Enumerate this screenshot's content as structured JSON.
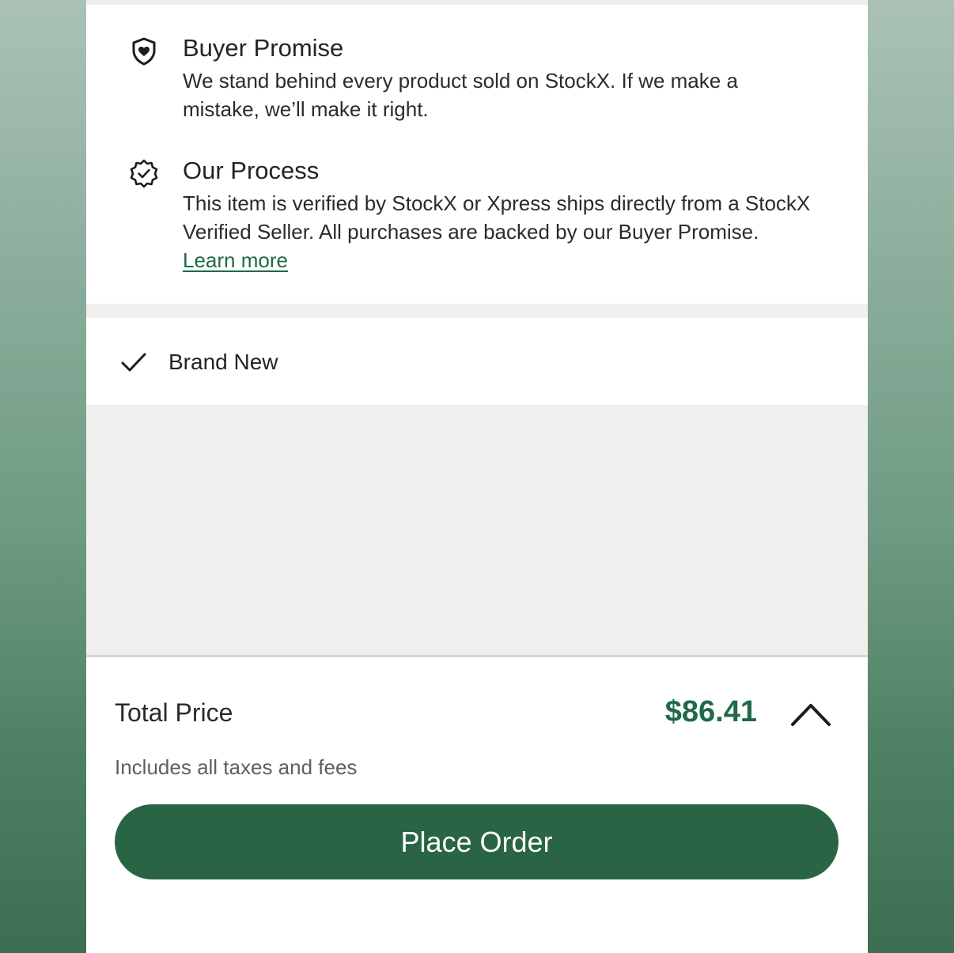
{
  "buyer_promise": {
    "icon": "shield-heart-icon",
    "title": "Buyer Promise",
    "body": "We stand behind every product sold on StockX. If we make a mistake, we’ll make it right."
  },
  "our_process": {
    "icon": "verified-badge-icon",
    "title": "Our Process",
    "body": "This item is verified by StockX or Xpress ships directly from a StockX Verified Seller. All purchases are backed by our Buyer Promise.",
    "link_label": "Learn more"
  },
  "condition": {
    "icon": "checkmark-icon",
    "label": "Brand New"
  },
  "footer": {
    "total_label": "Total Price",
    "total_value": "$86.41",
    "chevron_icon": "chevron-up-icon",
    "taxes_note": "Includes all taxes and fees",
    "place_order_label": "Place Order"
  },
  "colors": {
    "accent_green": "#296445",
    "price_green": "#1f6a47",
    "panel_gray": "#f0efed"
  }
}
